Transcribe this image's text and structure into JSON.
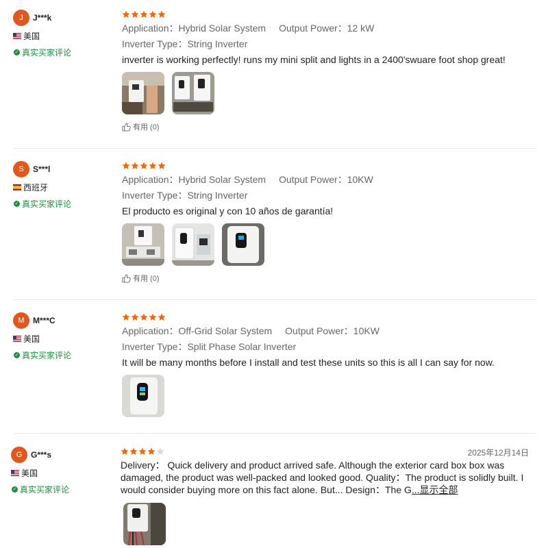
{
  "colors": {
    "star": "#ff6600",
    "star_empty": "#d9d9d9",
    "verified": "#1e8e3e",
    "avatar": "#e2571e"
  },
  "reviews": [
    {
      "initial": "J",
      "username": "J***k",
      "country": "美国",
      "flag": "us",
      "verified": "真实买家评论",
      "rating": 5,
      "application_label": "Application：",
      "application": "Hybrid Solar System",
      "output_label": "Output Power：",
      "output": "12 kW",
      "inverter_label": "Inverter Type：",
      "inverter": "String Inverter",
      "text": "inverter is working perfectly! runs my mini split and lights in a 2400'swuare foot shop great!",
      "photos": [
        "inverter-install-photo",
        "inverter-wall-photo"
      ],
      "helpful": "有用 (0)"
    },
    {
      "initial": "S",
      "username": "S***l",
      "country": "西班牙",
      "flag": "es",
      "verified": "真实买家评论",
      "rating": 5,
      "application_label": "Application：",
      "application": "Hybrid Solar System",
      "output_label": "Output Power：",
      "output": "10KW",
      "inverter_label": "Inverter Type：",
      "inverter": "String Inverter",
      "text": "El producto es original y con 10 años de garantía!",
      "photos": [
        "inverter-panel-photo",
        "inverter-breaker-photo",
        "inverter-closeup-photo"
      ],
      "helpful": "有用 (0)"
    },
    {
      "initial": "M",
      "username": "M***C",
      "country": "美国",
      "flag": "us",
      "verified": "真实买家评论",
      "rating": 5,
      "application_label": "Application：",
      "application": "Off-Grid Solar System",
      "output_label": "Output Power：",
      "output": "10KW",
      "inverter_label": "Inverter Type：",
      "inverter": "Split Phase Solar Inverter",
      "text": "It will be many months before I install and test these units so this is all I can say for now.",
      "photos": [
        "inverter-unit-photo"
      ]
    },
    {
      "initial": "G",
      "username": "G***s",
      "country": "美国",
      "flag": "us",
      "verified": "真实买家评论",
      "rating": 4,
      "date": "2025年12月14日",
      "long_text": "Delivery：  Quick delivery and product arrived safe. Although the exterior card box box was damaged, the product was well-packed and looked good. Quality：The product is solidly built. I would consider buying more on this fact alone. But...   Design：The G",
      "show_all": "...显示全部",
      "photos": [
        "inverter-wiring-photo"
      ]
    }
  ]
}
